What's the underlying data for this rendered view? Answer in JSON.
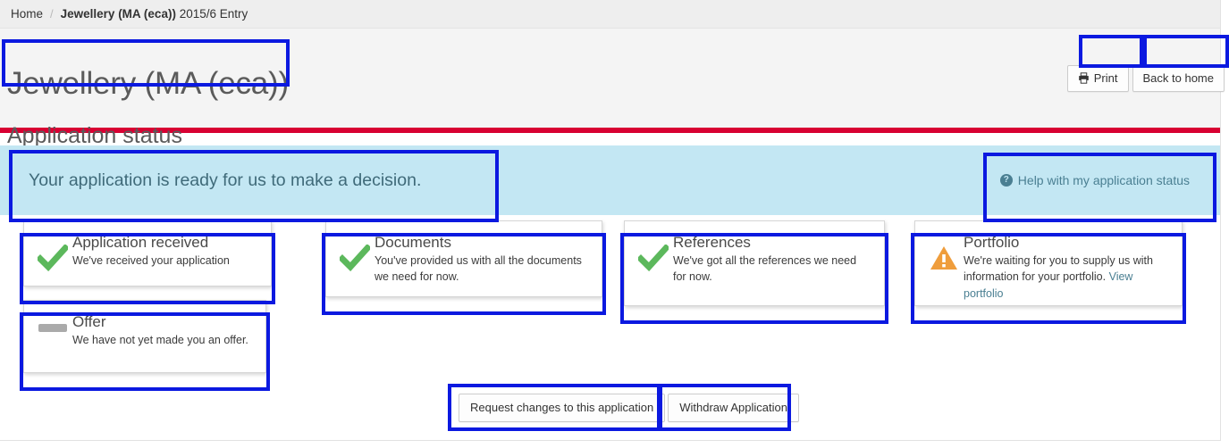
{
  "breadcrumb": {
    "home_label": "Home",
    "separator": "/",
    "course_name": "Jewellery (MA (eca))",
    "entry_year": " 2015/6 Entry"
  },
  "header": {
    "page_title": "Jewellery (MA (eca))",
    "section_title": "Application status",
    "print_label": "Print",
    "print_icon": "printer-icon",
    "back_home_label": "Back to home",
    "accent_color": "#d80032"
  },
  "banner": {
    "message": "Your application is ready for us to make a decision.",
    "help_label": "Help with my application status",
    "help_icon": "question-circle-icon",
    "background_color": "#c3e7f3",
    "text_color": "#3f6a79"
  },
  "cards": [
    {
      "id": "application-received",
      "title": "Application received",
      "description": "We've received your application",
      "icon": "green-check-icon",
      "status": "complete",
      "status_color": "#5cb85c"
    },
    {
      "id": "documents",
      "title": "Documents",
      "description": "You've provided us with all the documents we need for now.",
      "icon": "green-check-icon",
      "status": "complete",
      "status_color": "#5cb85c"
    },
    {
      "id": "references",
      "title": "References",
      "description": "We've got all the references we need for now.",
      "icon": "green-check-icon",
      "status": "complete",
      "status_color": "#5cb85c"
    },
    {
      "id": "portfolio",
      "title": "Portfolio",
      "description": "We're waiting for you to supply us with information for your portfolio. ",
      "link_label": "View portfolio",
      "icon": "orange-warning-triangle-icon",
      "status": "action-required",
      "status_color": "#ef9d3c"
    },
    {
      "id": "offer",
      "title": "Offer",
      "description": "We have not yet made you an offer.",
      "icon": "grey-dash-icon",
      "status": "pending",
      "status_color": "#aaaaaa"
    }
  ],
  "bottom_actions": {
    "request_changes_label": "Request changes to this application",
    "withdraw_label": "Withdraw Application"
  }
}
